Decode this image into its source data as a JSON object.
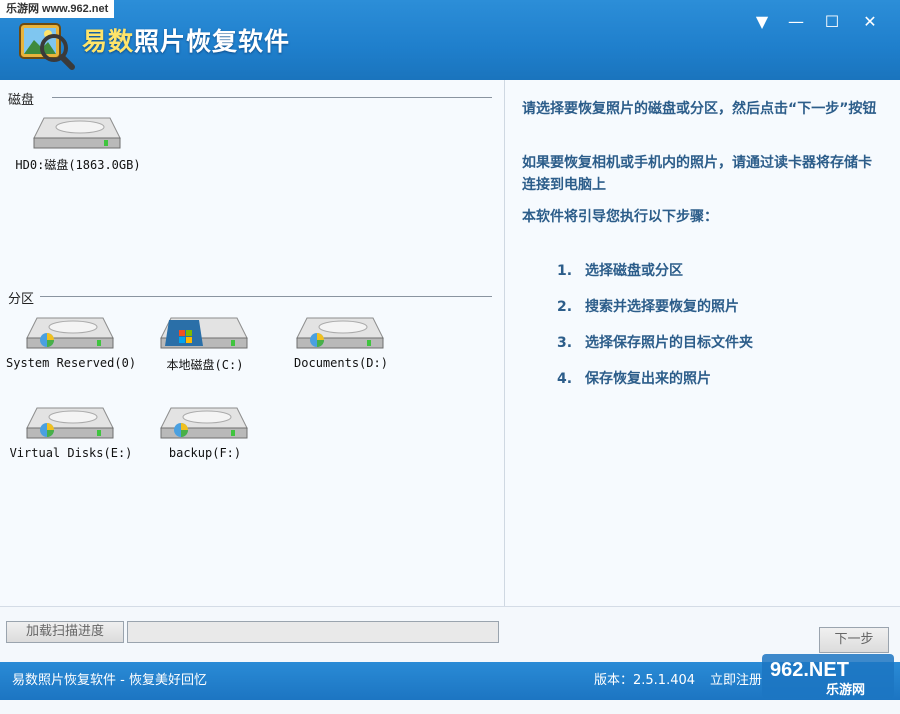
{
  "watermark_top": "乐游网 www.962.net",
  "app": {
    "title_first": "易数",
    "title_rest": "照片恢复软件"
  },
  "window_buttons": {
    "menu": "▼",
    "minimize": "—",
    "maximize": "☐",
    "close": "✕"
  },
  "disks": {
    "group_label": "磁盘",
    "items": [
      {
        "label": "HD0:磁盘(1863.0GB)",
        "icon": "hard-disk-icon"
      }
    ]
  },
  "partitions": {
    "group_label": "分区",
    "items": [
      {
        "label": "System Reserved(0)",
        "icon": "partition-drive-icon"
      },
      {
        "label": "本地磁盘(C:)",
        "icon": "windows-system-drive-icon"
      },
      {
        "label": "Documents(D:)",
        "icon": "partition-drive-icon"
      },
      {
        "label": "Virtual Disks(E:)",
        "icon": "partition-drive-icon"
      },
      {
        "label": "backup(F:)",
        "icon": "partition-drive-icon"
      }
    ]
  },
  "instructions": {
    "line1": "请选择要恢复照片的磁盘或分区，然后点击“下一步”按钮",
    "line2": "如果要恢复相机或手机内的照片，请通过读卡器将存储卡连接到电脑上",
    "line3": "本软件将引导您执行以下步骤：",
    "steps": [
      {
        "num": "1.",
        "text": "选择磁盘或分区"
      },
      {
        "num": "2.",
        "text": "搜索并选择要恢复的照片"
      },
      {
        "num": "3.",
        "text": "选择保存照片的目标文件夹"
      },
      {
        "num": "4.",
        "text": "保存恢复出来的照片"
      }
    ]
  },
  "toolbar": {
    "load_scan_progress": "加载扫描进度",
    "progress_fraction": 0,
    "next": "下一步"
  },
  "statusbar": {
    "slogan": "易数照片恢复软件 - 恢复美好回忆",
    "version": "版本：2.5.1.404",
    "register": "立即注册"
  },
  "watermark_bottom": {
    "top": "962.NET",
    "bottom": "乐游网"
  },
  "colors": {
    "title_bar": "#1f7fcc",
    "instruction_text": "#2c5d8a",
    "title_accent": "#ffe46a"
  }
}
